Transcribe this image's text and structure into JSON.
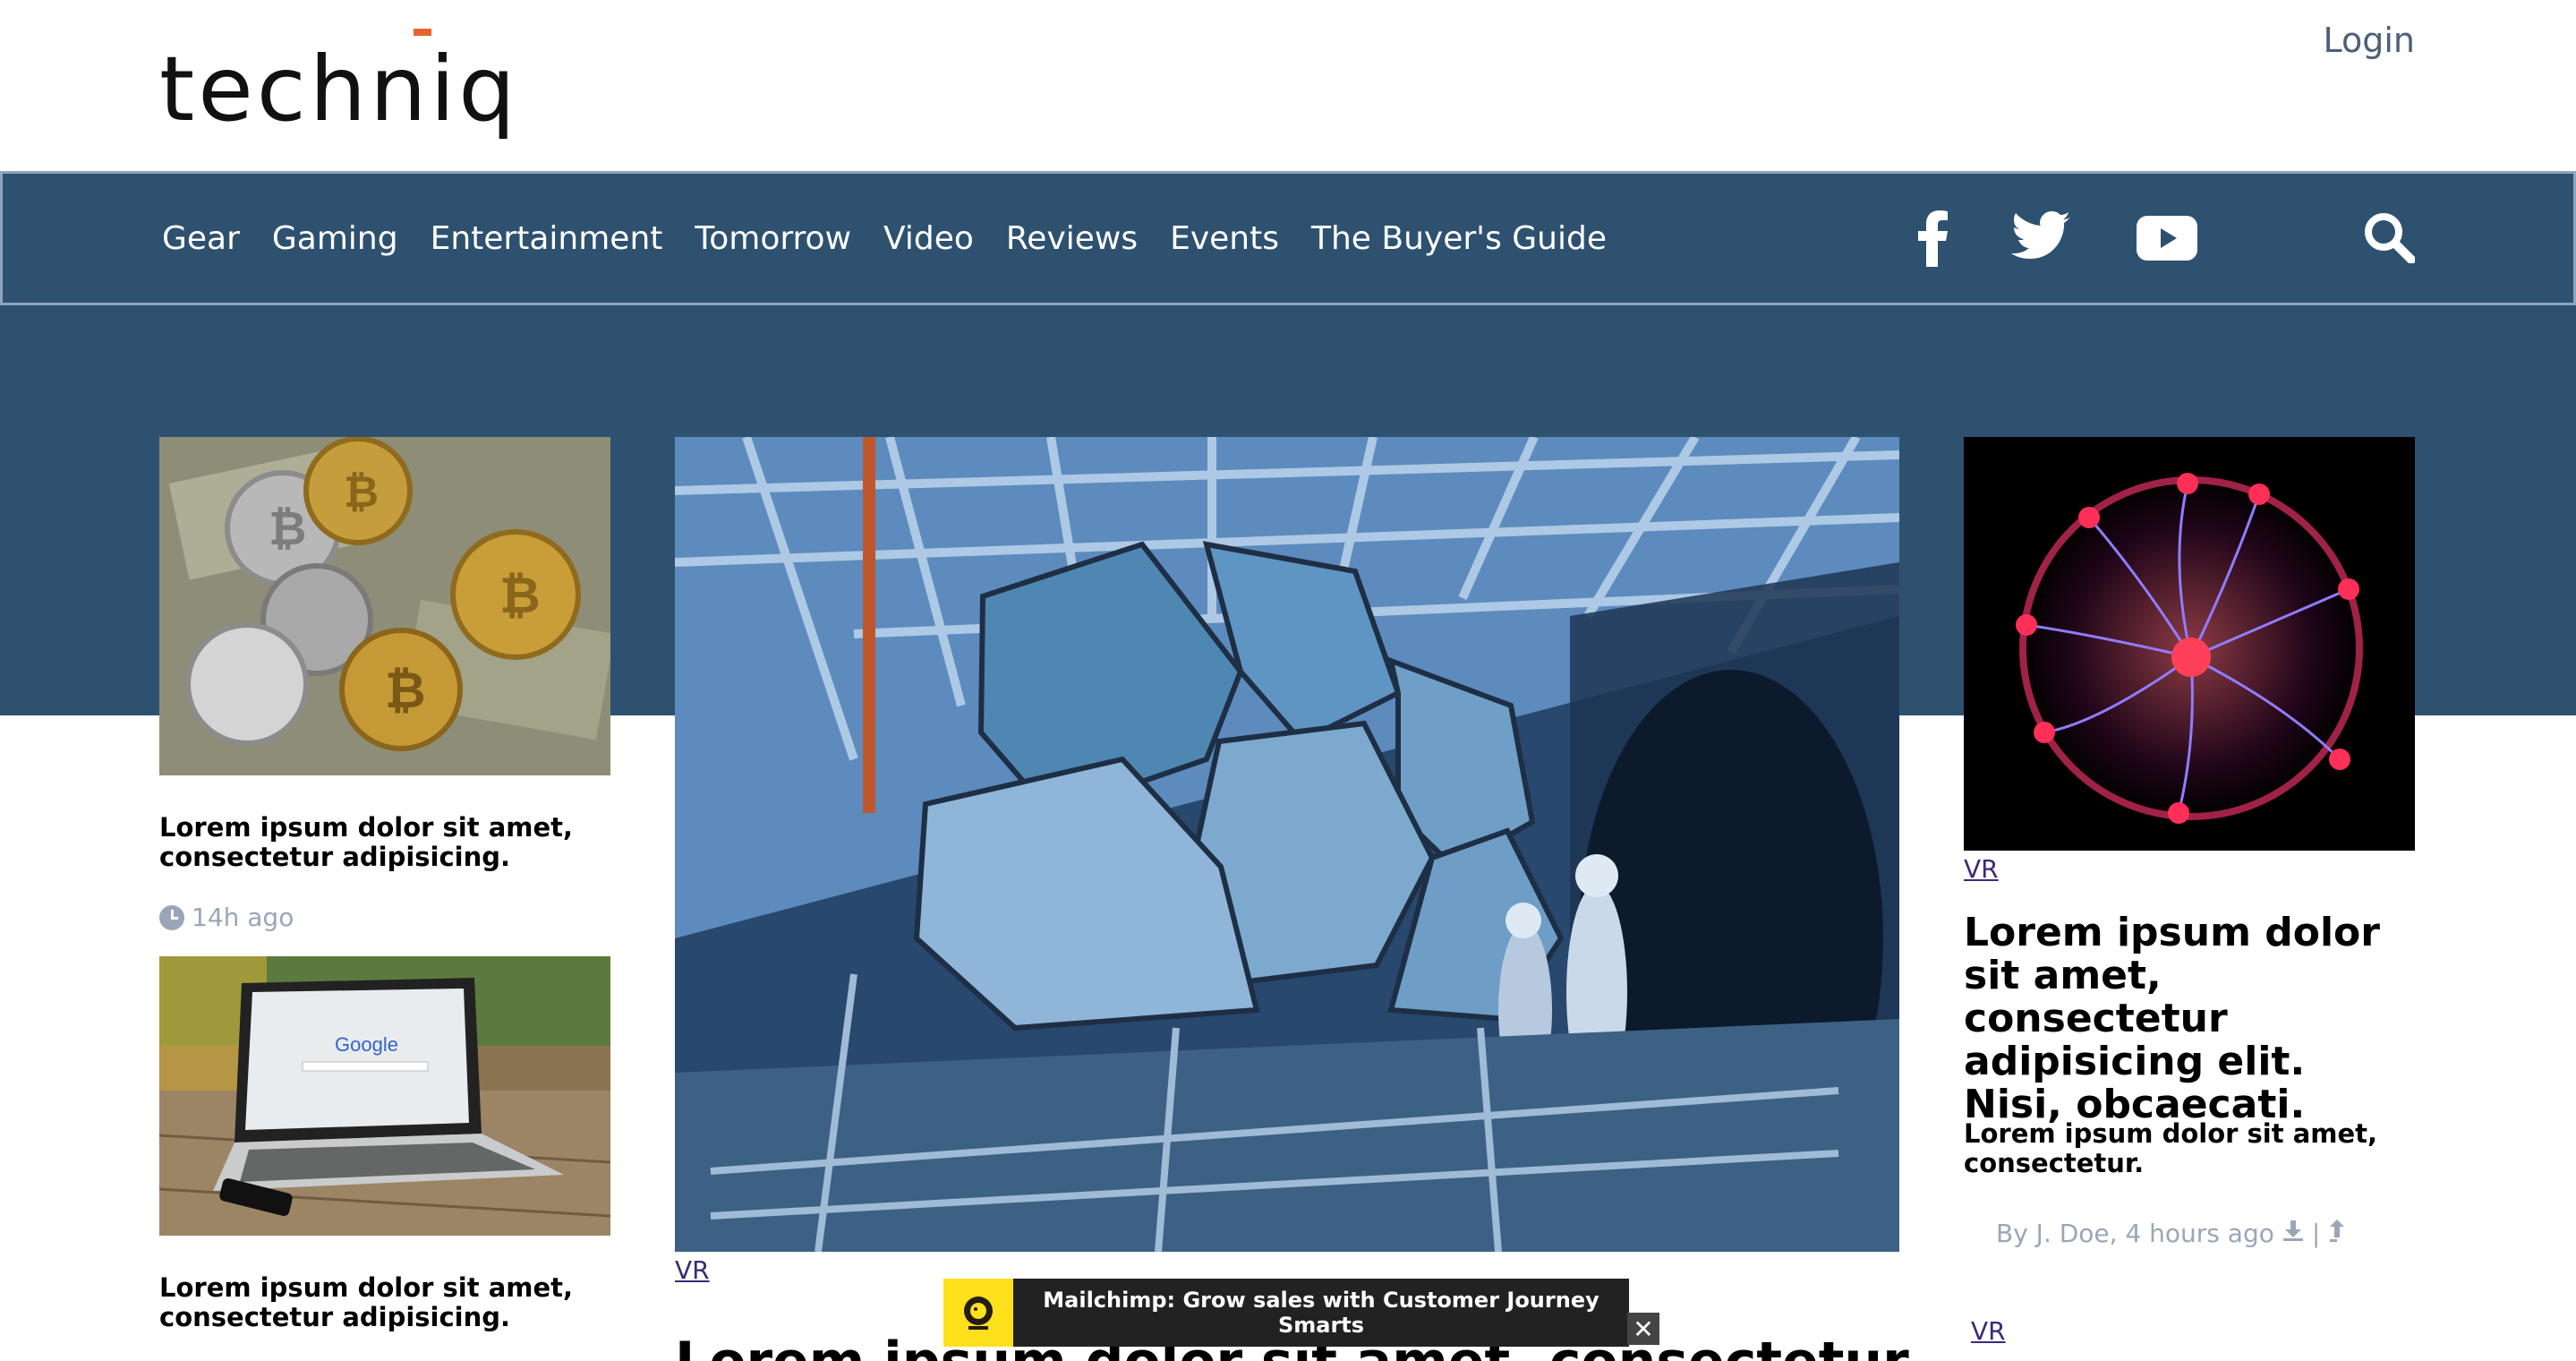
{
  "header": {
    "logo_text": "techniq",
    "login_label": "Login"
  },
  "nav": {
    "items": [
      "Gear",
      "Gaming",
      "Entertainment",
      "Tomorrow",
      "Video",
      "Reviews",
      "Events",
      "The Buyer's Guide"
    ],
    "social_icons": [
      "facebook-icon",
      "twitter-icon",
      "youtube-icon"
    ],
    "search_icon": "search-icon"
  },
  "left_column": {
    "articles": [
      {
        "title": "Lorem ipsum dolor sit amet, consectetur adipisicing.",
        "time": "14h ago"
      },
      {
        "title": "Lorem ipsum dolor sit amet, consectetur adipisicing."
      }
    ]
  },
  "center": {
    "tag": "VR",
    "headline": "Lorem ipsum dolor sit amet, consectetur"
  },
  "right_column": {
    "tag": "VR",
    "headline": "Lorem ipsum dolor sit amet, consectetur adipisicing elit. Nisi, obcaecati.",
    "subtitle": "Lorem ipsum dolor sit amet, consectetur.",
    "byline": "By J. Doe, 4 hours ago",
    "byline_sep": "|",
    "tag2": "VR"
  },
  "ad": {
    "text": "Mailchimp: Grow sales with Customer Journey Smarts",
    "close_label": "✕"
  },
  "colors": {
    "nav_bg": "#2e5170",
    "accent": "#e8642c",
    "muted": "#9aa6b8",
    "link": "#3b2a7a"
  }
}
